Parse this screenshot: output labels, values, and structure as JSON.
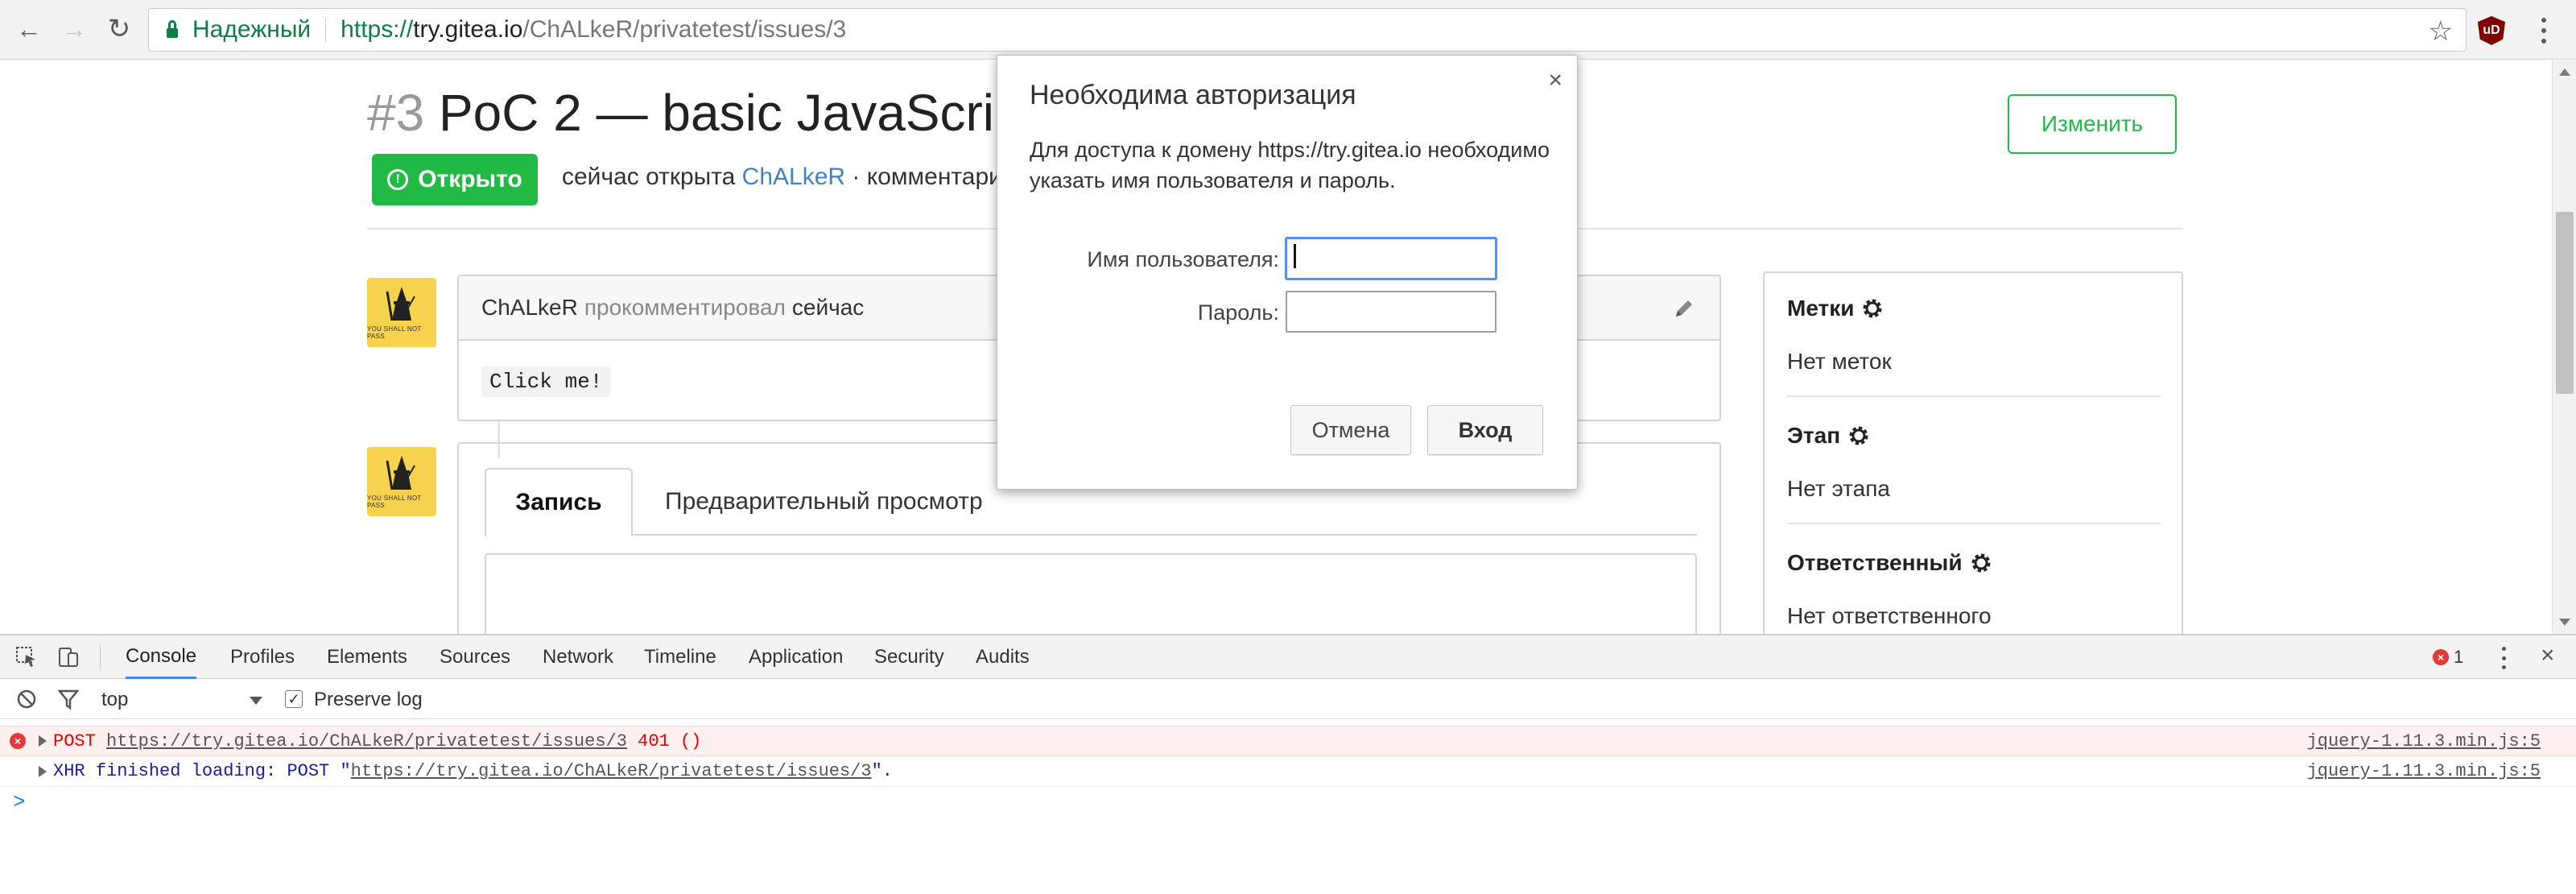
{
  "browser": {
    "secure_label": "Надежный",
    "url_scheme": "https://",
    "url_host": "try.gitea.io",
    "url_path": "/ChALkeR/privatetest/issues/3",
    "ublock_label": "uD"
  },
  "issue": {
    "number": "#3",
    "title": "PoC 2 — basic JavaScrip",
    "status": "Открыто",
    "meta_prefix": "сейчас открыта",
    "author": "ChALkeR",
    "meta_suffix": "· комментариев",
    "edit_label": "Изменить"
  },
  "comment": {
    "author": "ChALkeR",
    "action": "прокомментировал",
    "time": "сейчас",
    "code": "Click me!"
  },
  "editor": {
    "tab_write": "Запись",
    "tab_preview": "Предварительный просмотр"
  },
  "sidebar": {
    "labels_title": "Метки",
    "labels_value": "Нет меток",
    "milestone_title": "Этап",
    "milestone_value": "Нет этапа",
    "assignee_title": "Ответственный",
    "assignee_value": "Нет ответственного"
  },
  "avatar_caption": "YOU SHALL NOT PASS",
  "auth_dialog": {
    "title": "Необходима авторизация",
    "message": "Для доступа к домену https://try.gitea.io необходимо указать имя пользователя и пароль.",
    "username_label": "Имя пользователя:",
    "password_label": "Пароль:",
    "username_value": "",
    "password_value": "",
    "cancel_label": "Отмена",
    "login_label": "Вход",
    "close_glyph": "×"
  },
  "devtools": {
    "tabs": [
      "Console",
      "Profiles",
      "Elements",
      "Sources",
      "Network",
      "Timeline",
      "Application",
      "Security",
      "Audits"
    ],
    "active_tab": "Console",
    "error_count": "1",
    "context": "top",
    "preserve_log_label": "Preserve log",
    "preserve_log_checked": true,
    "messages": [
      {
        "level": "error",
        "prefix": "POST ",
        "url": "https://try.gitea.io/ChALkeR/privatetest/issues/3",
        "suffix": " 401 ()",
        "source": "jquery-1.11.3.min.js:5"
      },
      {
        "level": "info",
        "prefix": "XHR finished loading: POST \"",
        "url": "https://try.gitea.io/ChALkeR/privatetest/issues/3",
        "suffix": "\".",
        "source": "jquery-1.11.3.min.js:5"
      }
    ],
    "prompt_glyph": ">"
  },
  "colors": {
    "accent_green": "#21ba45",
    "link_blue": "#4183c4",
    "devtools_active": "#4285f4",
    "error_red": "#e53935"
  }
}
